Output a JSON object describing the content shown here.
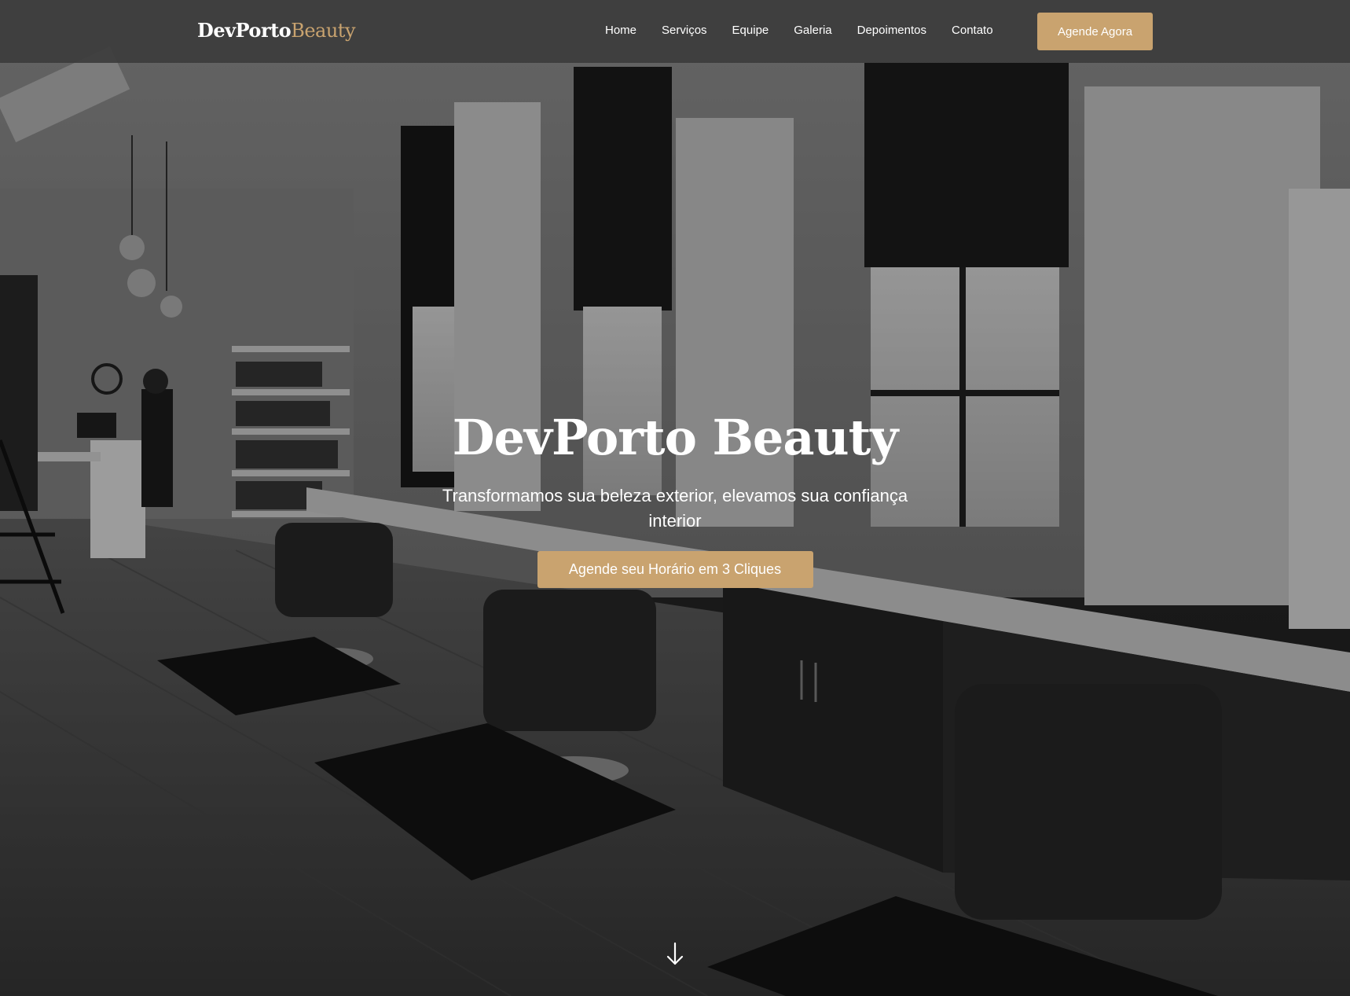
{
  "brand": {
    "name_main": "DevPorto",
    "name_accent": "Beauty",
    "accent_color": "#c9a36f"
  },
  "nav": {
    "items": [
      {
        "label": "Home"
      },
      {
        "label": "Serviços"
      },
      {
        "label": "Equipe"
      },
      {
        "label": "Galeria"
      },
      {
        "label": "Depoimentos"
      },
      {
        "label": "Contato"
      }
    ],
    "cta_label": "Agende Agora"
  },
  "hero": {
    "title": "DevPorto Beauty",
    "subtitle": "Transformamos sua beleza exterior, elevamos sua confiança interior",
    "cta_label": "Agende seu Horário em 3 Cliques",
    "scroll_icon": "arrow-down-icon",
    "background": "salon-interior-photo"
  }
}
